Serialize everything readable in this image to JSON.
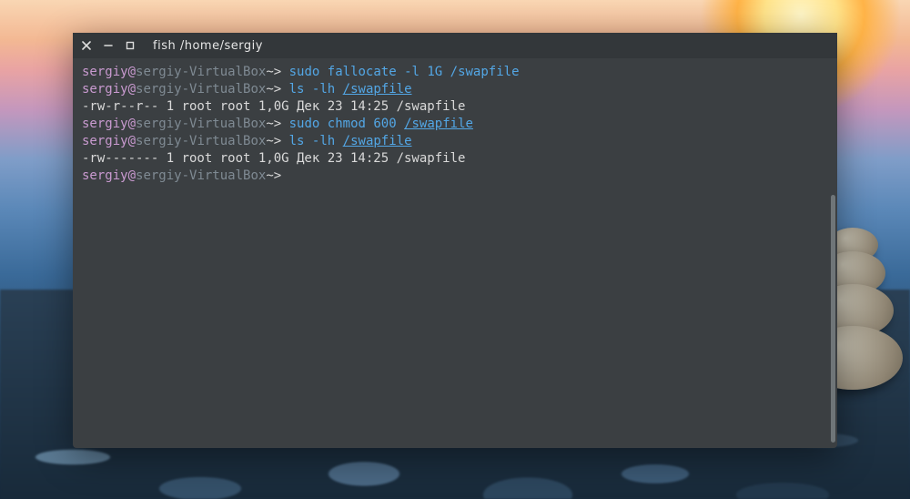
{
  "window": {
    "title": "fish /home/sergiy"
  },
  "prompt": {
    "user": "sergiy",
    "at": "@",
    "host": "sergiy-VirtualBox",
    "tilde": "~",
    "gt": ">"
  },
  "lines": [
    {
      "cmd": "sudo",
      "rest": "fallocate -l 1G /swapfile"
    },
    {
      "cmd": "ls",
      "opt": "-lh",
      "path": "/swapfile"
    },
    {
      "output": "-rw-r--r-- 1 root root 1,0G Дек 23 14:25 /swapfile"
    },
    {
      "cmd": "sudo",
      "rest_pre": "chmod 600 ",
      "path": "/swapfile"
    },
    {
      "cmd": "ls",
      "opt": "-lh",
      "path": "/swapfile"
    },
    {
      "output": "-rw------- 1 root root 1,0G Дек 23 14:25 /swapfile"
    },
    {
      "empty_prompt": true
    }
  ]
}
